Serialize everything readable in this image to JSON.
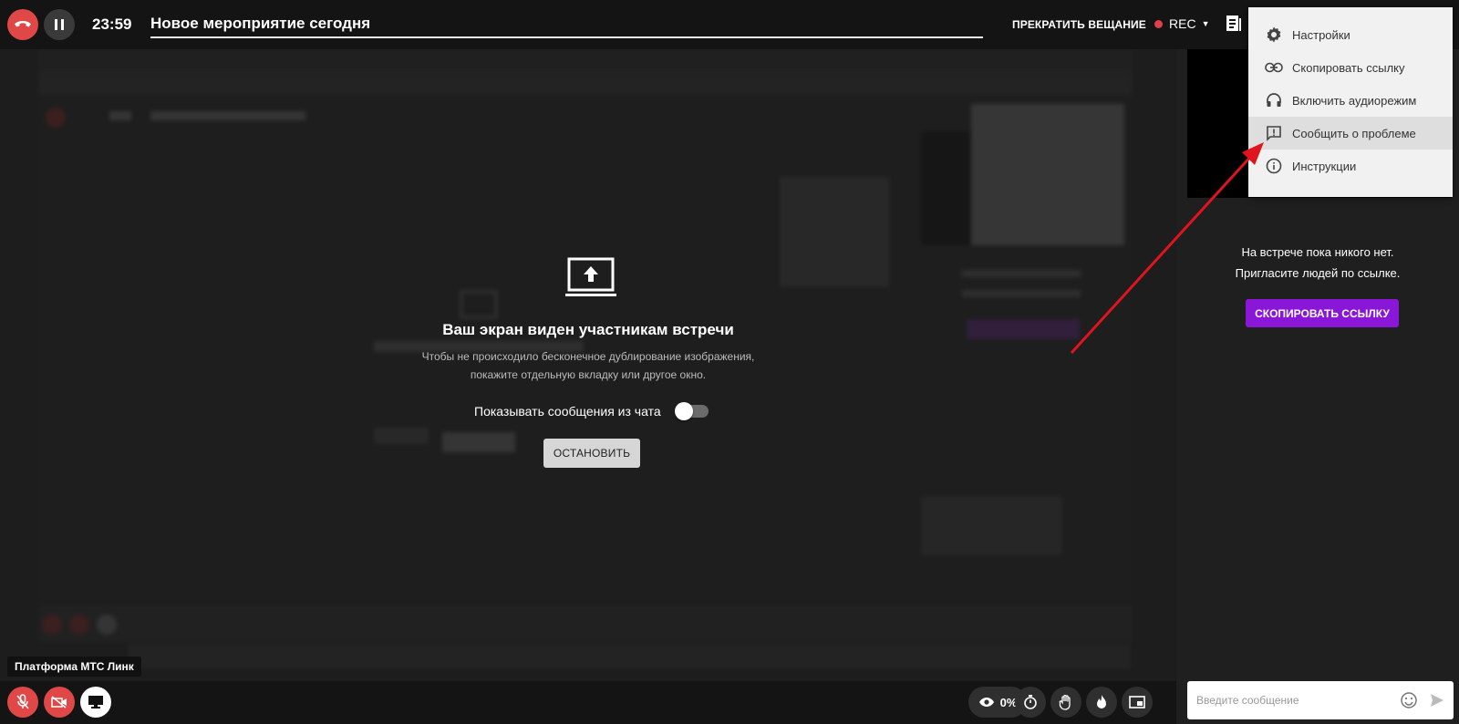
{
  "header": {
    "timer": "23:59",
    "event_title": "Новое мероприятие сегодня",
    "stop_broadcast_label": "ПРЕКРАТИТЬ ВЕЩАНИЕ",
    "rec_label": "REC"
  },
  "menu": {
    "items": [
      {
        "label": "Настройки",
        "icon": "gear-icon"
      },
      {
        "label": "Скопировать ссылку",
        "icon": "link-icon"
      },
      {
        "label": "Включить аудиорежим",
        "icon": "headphones-icon"
      },
      {
        "label": "Сообщить о проблеме",
        "icon": "report-icon",
        "highlighted": true
      },
      {
        "label": "Инструкции",
        "icon": "info-icon"
      }
    ]
  },
  "screen_share": {
    "title": "Ваш экран виден участникам встречи",
    "subtitle_line1": "Чтобы не происходило бесконечное дублирование изображения,",
    "subtitle_line2": "покажите отдельную вкладку или другое окно.",
    "chat_toggle_label": "Показывать сообщения из чата",
    "chat_toggle_on": false,
    "stop_button_label": "ОСТАНОВИТЬ"
  },
  "tooltip": {
    "text": "Платформа МТС Линк"
  },
  "bottom_bar": {
    "viewers_percent": "0%"
  },
  "right_panel": {
    "empty_line1": "На встрече пока никого нет.",
    "empty_line2": "Пригласите людей по ссылке.",
    "copy_link_button": "СКОПИРОВАТЬ ССЫЛКУ",
    "message_placeholder": "Введите сообщение"
  },
  "colors": {
    "accent_purple": "#8a16d8",
    "danger_red": "#e04848",
    "annotation_arrow": "#e0141e"
  }
}
